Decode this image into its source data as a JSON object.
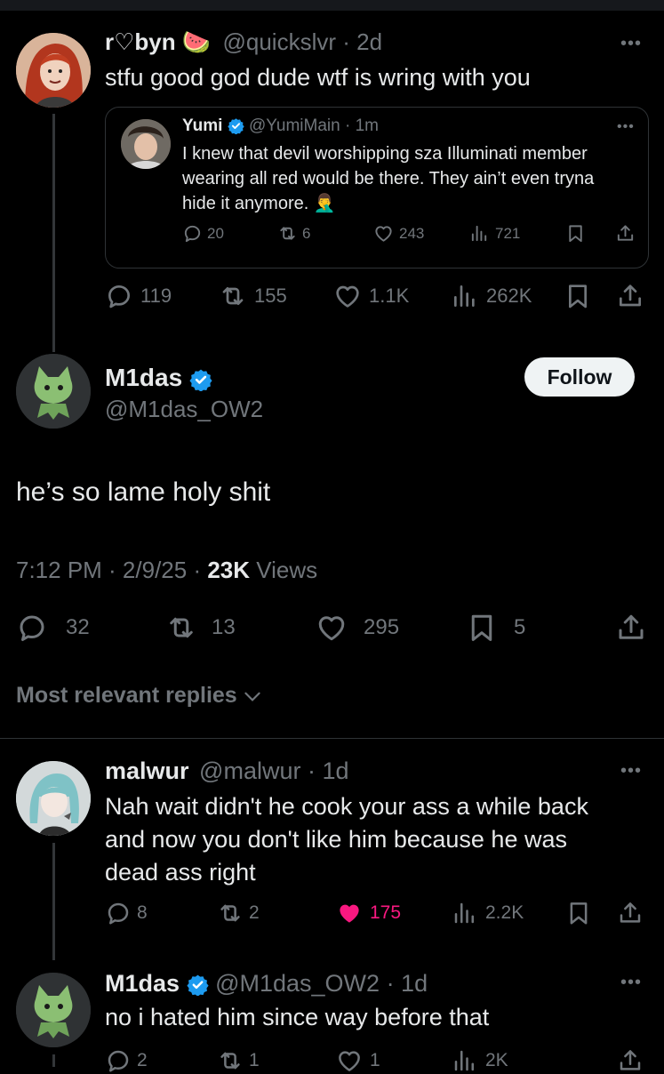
{
  "tweet1": {
    "name": "r♡byn 🍉",
    "handle": "@quickslvr",
    "time": "· 2d",
    "text": "stfu good god dude wtf is wring with you",
    "quote": {
      "name": "Yumi",
      "handle": "@YumiMain",
      "time": "· 1m",
      "line1": "I knew that devil worshipping sza Illuminati member",
      "line2": "wearing all red would be there. They ain’t even tryna",
      "line3": "hide it anymore. 🤦‍♂️",
      "replies": "20",
      "reposts": "6",
      "likes": "243",
      "views": "721"
    },
    "replies": "119",
    "reposts": "155",
    "likes": "1.1K",
    "views": "262K"
  },
  "main": {
    "name": "M1das",
    "handle": "@M1das_OW2",
    "follow_label": "Follow",
    "text": "he’s so lame holy shit",
    "time": "7:12 PM · 2/9/25 ·",
    "views_count": "23K",
    "views_label": "Views",
    "replies": "32",
    "reposts": "13",
    "likes": "295",
    "bookmarks": "5"
  },
  "sort_label": "Most relevant replies",
  "reply1": {
    "name": "malwur",
    "handle": "@malwur",
    "time": "· 1d",
    "line1": "Nah wait didn't he cook your ass a while back",
    "line2": "and now you don't like him because he was",
    "line3": "dead ass right",
    "replies": "8",
    "reposts": "2",
    "likes": "175",
    "views": "2.2K"
  },
  "reply2": {
    "name": "M1das",
    "handle": "@M1das_OW2",
    "time": "· 1d",
    "text": "no i hated him since way before that",
    "replies": "2",
    "reposts": "1",
    "likes": "1",
    "views": "2K"
  },
  "colors": {
    "verified": "#1d9bf0",
    "liked": "#f91880",
    "muted": "#71767b"
  },
  "icons": [
    "reply-icon",
    "repost-icon",
    "like-icon",
    "views-icon",
    "bookmark-icon",
    "share-icon",
    "verified-icon",
    "more-icon",
    "chevron-down-icon"
  ]
}
